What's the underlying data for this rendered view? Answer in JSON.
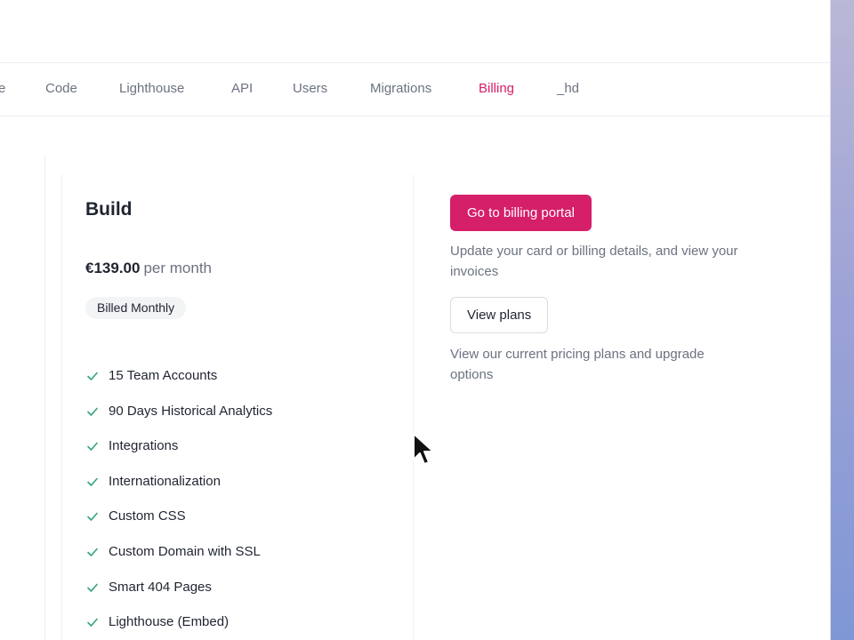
{
  "nav": {
    "tabs": [
      {
        "label": "e"
      },
      {
        "label": "Code"
      },
      {
        "label": "Lighthouse"
      },
      {
        "label": "API"
      },
      {
        "label": "Users"
      },
      {
        "label": "Migrations"
      },
      {
        "label": "Billing",
        "active": true
      },
      {
        "label": "_hd"
      }
    ]
  },
  "plan": {
    "name": "Build",
    "price": "€139.00",
    "period": "per month",
    "billing_badge": "Billed Monthly",
    "features": [
      "15 Team Accounts",
      "90 Days Historical Analytics",
      "Integrations",
      "Internationalization",
      "Custom CSS",
      "Custom Domain with SSL",
      "Smart 404 Pages",
      "Lighthouse (Embed)"
    ]
  },
  "billing": {
    "portal_button": "Go to billing portal",
    "portal_help": "Update your card or billing details, and view your invoices",
    "plans_button": "View plans",
    "plans_help": "View our current pricing plans and upgrade options"
  },
  "icons": {
    "feature_icon": "check-icon",
    "cursor_icon": "mouse-pointer-icon"
  },
  "colors": {
    "accent": "#d61f69",
    "check": "#34a37a",
    "muted_text": "#6b7280"
  }
}
